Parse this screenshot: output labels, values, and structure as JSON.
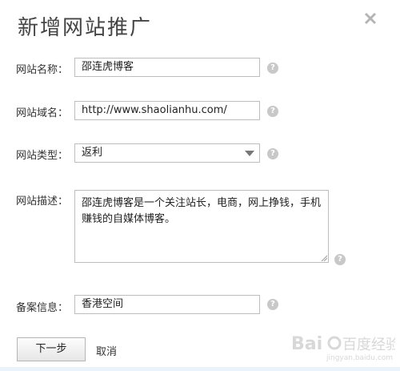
{
  "dialog": {
    "title": "新增网站推广",
    "close_icon": "close-icon"
  },
  "form": {
    "site_name": {
      "label": "网站名称：",
      "value": "邵连虎博客",
      "help_icon": "question-icon"
    },
    "site_domain": {
      "label": "网站域名：",
      "value": "http://www.shaolianhu.com/",
      "help_icon": "question-icon"
    },
    "site_type": {
      "label": "网站类型：",
      "selected": "返利",
      "help_icon": "question-icon"
    },
    "site_desc": {
      "label": "网站描述：",
      "value": "邵连虎博客是一个关注站长，电商，网上挣钱，手机赚钱的自媒体博客。",
      "help_icon": "question-icon"
    },
    "icp_info": {
      "label": "备案信息：",
      "value": "香港空间",
      "help_icon": "question-icon"
    }
  },
  "actions": {
    "next_label": "下一步",
    "cancel_label": "取消"
  },
  "watermark": {
    "text": "Bai百度经验",
    "sub": "jingyan.baidu.com"
  },
  "colors": {
    "border": "#bdbdbd",
    "help_icon": "#c8c8c8",
    "title": "#444444"
  }
}
